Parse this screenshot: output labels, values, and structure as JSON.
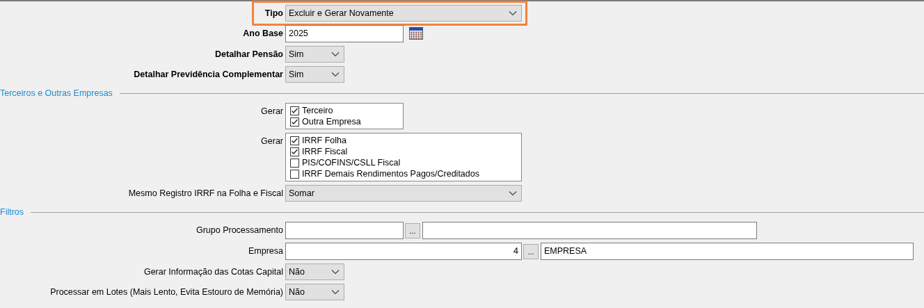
{
  "main_fields": [
    {
      "label": "Tipo",
      "kind": "dropdown",
      "value": "Excluir e Gerar Novamente",
      "highlighted": true
    },
    {
      "label": "Ano Base",
      "kind": "date",
      "value": "2025",
      "highlighted": false
    },
    {
      "label": "Detalhar Pensão",
      "kind": "small-dropdown",
      "value": "Sim",
      "highlighted": false
    },
    {
      "label": "Detalhar Previdência Complementar",
      "kind": "small-dropdown",
      "value": "Sim",
      "highlighted": false
    }
  ],
  "sections": [
    {
      "title": "Terceiros e Outras Empresas",
      "fields": [
        {
          "label": "Gerar",
          "kind": "checklist",
          "options": [
            {
              "label": "Terceiro",
              "checked": true
            },
            {
              "label": "Outra Empresa",
              "checked": true
            }
          ]
        },
        {
          "label": "Gerar",
          "kind": "wide-checklist",
          "options": [
            {
              "label": "IRRF Folha",
              "checked": true
            },
            {
              "label": "IRRF Fiscal",
              "checked": true
            },
            {
              "label": "PIS/COFINS/CSLL Fiscal",
              "checked": false
            },
            {
              "label": "IRRF Demais Rendimentos Pagos/Creditados",
              "checked": false
            }
          ]
        },
        {
          "label": "Mesmo Registro IRRF na Folha e Fiscal",
          "kind": "dropdown",
          "value": "Somar"
        }
      ]
    },
    {
      "title": "Filtros",
      "fields": [
        {
          "label": "Grupo Processamento",
          "kind": "lookup",
          "button": "..."
        },
        {
          "label": "Empresa",
          "kind": "wide-lookup",
          "code": "4",
          "button": "...",
          "description": "EMPRESA"
        },
        {
          "label": "Gerar Informação das Cotas Capital",
          "kind": "small-dropdown",
          "value": "Não"
        },
        {
          "label": "Processar em Lotes (Mais Lento, Evita Estouro de Memória)",
          "kind": "small-dropdown",
          "value": "Não"
        }
      ]
    }
  ]
}
